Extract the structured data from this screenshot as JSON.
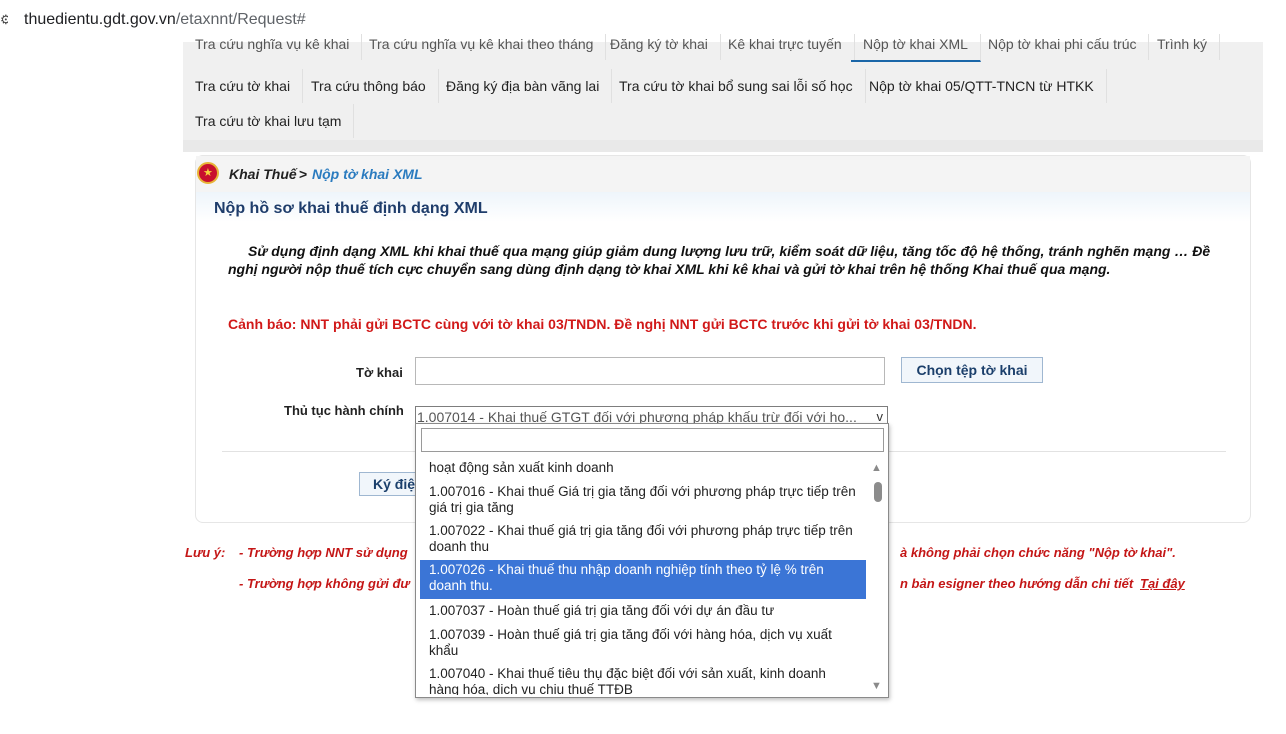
{
  "browser": {
    "url_host": "thuedientu.gdt.gov.vn",
    "url_path": "/etaxnnt/Request#"
  },
  "tabs": {
    "row0": [
      "Tra cứu nghĩa vụ kê khai",
      "Tra cứu nghĩa vụ kê khai theo tháng",
      "Đăng ký tờ khai",
      "Kê khai trực tuyến",
      "Nộp tờ khai XML",
      "Nộp tờ khai phi cấu trúc",
      "Trình ký"
    ],
    "row1": [
      "Tra cứu tờ khai",
      "Tra cứu thông báo",
      "Đăng ký địa bàn vãng lai",
      "Tra cứu tờ khai bổ sung sai lỗi số học",
      "Nộp tờ khai 05/QTT-TNCN từ HTKK"
    ],
    "row2": [
      "Tra cứu tờ khai lưu tạm"
    ]
  },
  "breadcrumb": {
    "parent": "Khai Thuế",
    "sep": ">",
    "current": "Nộp tờ khai XML"
  },
  "section_title": "Nộp hồ sơ khai thuế định dạng XML",
  "intro": "Sử dụng định dạng XML khi khai thuế qua mạng giúp giảm dung lượng lưu trữ, kiểm soát dữ liệu, tăng tốc độ hệ thống, tránh nghẽn mạng … Đề nghị người nộp thuế tích cực chuyển sang dùng định dạng tờ khai XML khi kê khai và gửi tờ khai trên hệ thống Khai thuế qua mạng.",
  "warning": "Cảnh báo: NNT phải gửi BCTC cùng với tờ khai 03/TNDN. Đề nghị NNT gửi BCTC trước khi gửi tờ khai 03/TNDN.",
  "form": {
    "to_khai_label": "Tờ khai",
    "choose_file_button": "Chọn tệp tờ khai",
    "thu_tuc_label": "Thủ tục hành chính",
    "thu_tuc_value": "1.007014 - Khai thuế GTGT đối với phương pháp khấu trừ đối với ho...",
    "chevron": "v",
    "sign_button": "Ký điệ"
  },
  "notes": {
    "prefix": "Lưu ý:",
    "line1_start": "- Trường hợp NNT sử dụng",
    "line1_end": "à không phải chọn chức năng \"Nộp tờ khai\".",
    "line2_start": "- Trường hợp không gửi đư",
    "line2_end": "n bản esigner theo hướng dẫn chi tiết",
    "link": "Tại đây"
  },
  "dropdown": {
    "search_value": "",
    "options": [
      "hoạt động sản xuất kinh doanh",
      "1.007016 - Khai thuế Giá trị gia tăng đối với phương pháp trực tiếp trên giá trị gia tăng",
      "1.007022 - Khai thuế giá trị gia tăng đối với phương pháp trực tiếp trên doanh thu",
      "1.007026 - Khai thuế thu nhập doanh nghiệp tính theo tỷ lệ % trên doanh thu.",
      "1.007037 - Hoàn thuế giá trị gia tăng đối với dự án đầu tư",
      "1.007039 - Hoàn thuế giá trị gia tăng đối với hàng hóa, dịch vụ xuất khẩu",
      "1.007040 - Khai thuế tiêu thụ đặc biệt đối với sản xuất, kinh doanh hàng hóa, dịch vụ chịu thuế TTĐB"
    ],
    "selected_index": 3
  },
  "colors": {
    "accent": "#3b75d6",
    "warning": "#d11919",
    "title": "#1f3d6b",
    "link": "#2a7bbf"
  }
}
